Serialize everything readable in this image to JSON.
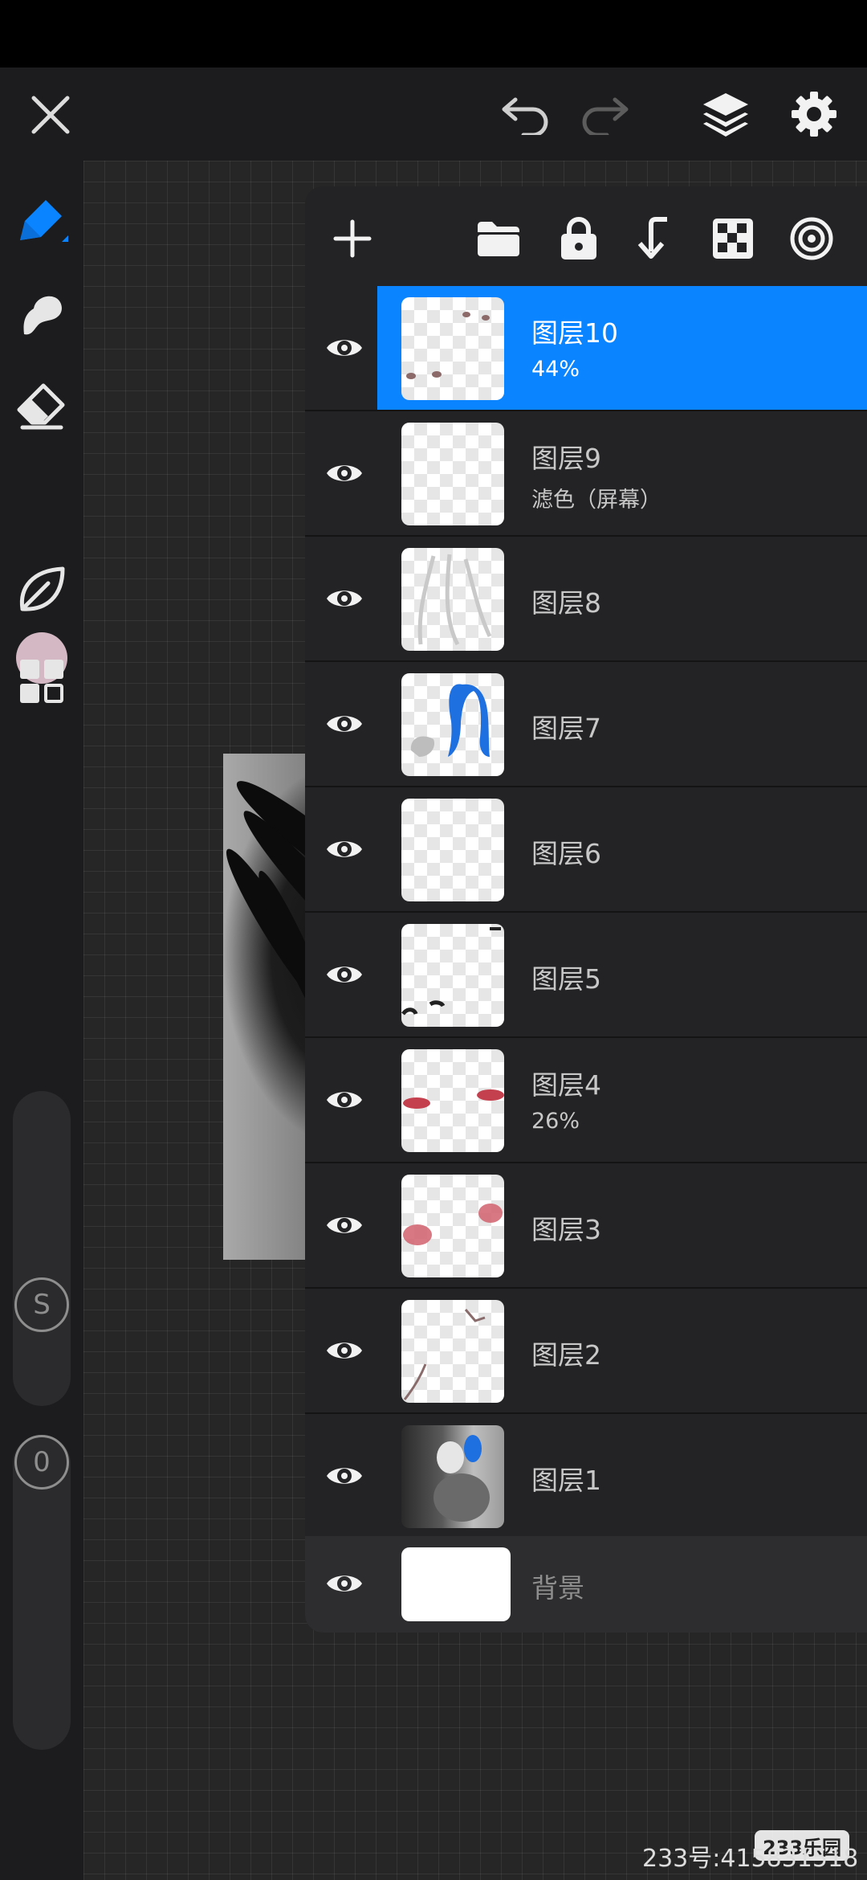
{
  "app": {
    "accent_color": "#0a84ff",
    "brush_color": "#d4b8c4"
  },
  "top_bar": {
    "icons": [
      "close-icon",
      "undo-icon",
      "redo-icon",
      "layers-icon",
      "settings-icon"
    ]
  },
  "left_toolbar": {
    "tools": [
      "brush-icon",
      "smudge-icon",
      "eraser-icon",
      "color-swatch",
      "liquify-leaf-icon",
      "gallery-grid-icon"
    ],
    "size_slider_label": "S",
    "opacity_slider_label": "0"
  },
  "layers_panel": {
    "toolbar_icons": [
      "add-icon",
      "folder-icon",
      "lock-icon",
      "merge-down-icon",
      "transparency-icon",
      "target-icon"
    ],
    "layers": [
      {
        "name": "图层10",
        "sub": "44%",
        "selected": true
      },
      {
        "name": "图层9",
        "sub": "滤色（屏幕）",
        "selected": false
      },
      {
        "name": "图层8",
        "sub": "",
        "selected": false
      },
      {
        "name": "图层7",
        "sub": "",
        "selected": false
      },
      {
        "name": "图层6",
        "sub": "",
        "selected": false
      },
      {
        "name": "图层5",
        "sub": "",
        "selected": false
      },
      {
        "name": "图层4",
        "sub": "26%",
        "selected": false
      },
      {
        "name": "图层3",
        "sub": "",
        "selected": false
      },
      {
        "name": "图层2",
        "sub": "",
        "selected": false
      },
      {
        "name": "图层1",
        "sub": "",
        "selected": false
      }
    ],
    "background_layer": {
      "name": "背景"
    }
  },
  "watermark": {
    "logo": "233乐园",
    "id_text": "233号:415831518"
  }
}
